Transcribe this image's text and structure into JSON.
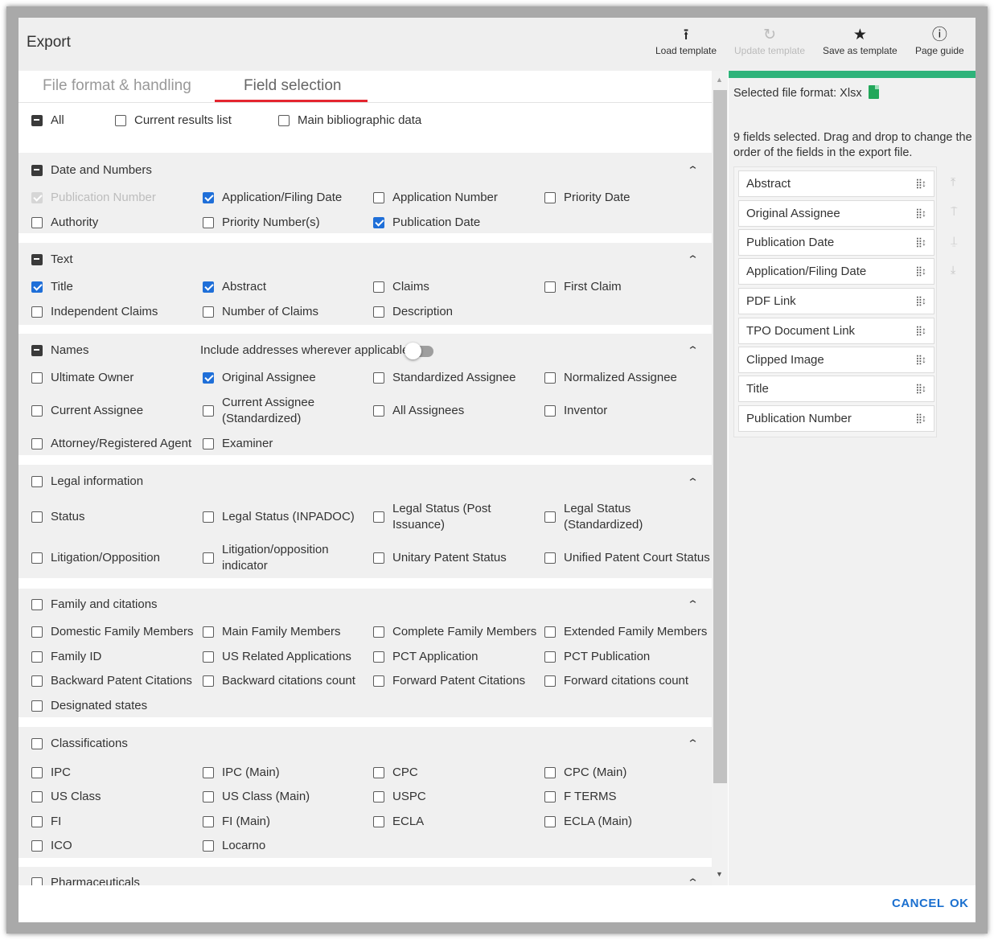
{
  "dialog": {
    "title": "Export"
  },
  "toolbar": [
    {
      "label": "Load template",
      "icon": "upload-icon",
      "enabled": true
    },
    {
      "label": "Update template",
      "icon": "refresh-icon",
      "enabled": false
    },
    {
      "label": "Save as template",
      "icon": "star-icon",
      "enabled": true
    },
    {
      "label": "Page guide",
      "icon": "info-icon",
      "enabled": true
    }
  ],
  "tabs": [
    {
      "label": "File format & handling",
      "active": false
    },
    {
      "label": "Field selection",
      "active": true
    }
  ],
  "top_checks": [
    {
      "label": "All",
      "state": "indeterminate"
    },
    {
      "label": "Current results list",
      "state": "unchecked"
    },
    {
      "label": "Main bibliographic data",
      "state": "unchecked"
    }
  ],
  "sections": {
    "date_numbers": {
      "title": "Date and Numbers",
      "state": "indeterminate",
      "fields": [
        {
          "label": "Publication Number",
          "state": "disabled"
        },
        {
          "label": "Application/Filing Date",
          "state": "checked"
        },
        {
          "label": "Application Number",
          "state": "unchecked"
        },
        {
          "label": "Priority Date",
          "state": "unchecked"
        },
        {
          "label": "Authority",
          "state": "unchecked"
        },
        {
          "label": "Priority Number(s)",
          "state": "unchecked"
        },
        {
          "label": "Publication Date",
          "state": "checked"
        }
      ]
    },
    "text": {
      "title": "Text",
      "state": "indeterminate",
      "fields": [
        {
          "label": "Title",
          "state": "checked"
        },
        {
          "label": "Abstract",
          "state": "checked"
        },
        {
          "label": "Claims",
          "state": "unchecked"
        },
        {
          "label": "First Claim",
          "state": "unchecked"
        },
        {
          "label": "Independent Claims",
          "state": "unchecked"
        },
        {
          "label": "Number of Claims",
          "state": "unchecked"
        },
        {
          "label": "Description",
          "state": "unchecked"
        }
      ]
    },
    "names": {
      "title": "Names",
      "state": "indeterminate",
      "addresses_label": "Include addresses wherever applicable",
      "fields": [
        {
          "label": "Ultimate Owner",
          "state": "unchecked"
        },
        {
          "label": "Original Assignee",
          "state": "checked"
        },
        {
          "label": "Standardized Assignee",
          "state": "unchecked"
        },
        {
          "label": "Normalized Assignee",
          "state": "unchecked"
        },
        {
          "label": "Current Assignee",
          "state": "unchecked"
        },
        {
          "label": "Current Assignee (Standardized)",
          "state": "unchecked"
        },
        {
          "label": "All Assignees",
          "state": "unchecked"
        },
        {
          "label": "Inventor",
          "state": "unchecked"
        },
        {
          "label": "Attorney/Registered Agent",
          "state": "unchecked"
        },
        {
          "label": "Examiner",
          "state": "unchecked"
        }
      ]
    },
    "legal": {
      "title": "Legal information",
      "state": "unchecked",
      "fields": [
        {
          "label": "Status",
          "state": "unchecked"
        },
        {
          "label": "Legal Status (INPADOC)",
          "state": "unchecked"
        },
        {
          "label": "Legal Status (Post Issuance)",
          "state": "unchecked"
        },
        {
          "label": "Legal Status (Standardized)",
          "state": "unchecked"
        },
        {
          "label": "Litigation/Opposition",
          "state": "unchecked"
        },
        {
          "label": "Litigation/opposition indicator",
          "state": "unchecked"
        },
        {
          "label": "Unitary Patent Status",
          "state": "unchecked"
        },
        {
          "label": "Unified Patent Court Status",
          "state": "unchecked"
        }
      ]
    },
    "family": {
      "title": "Family and citations",
      "state": "unchecked",
      "fields": [
        {
          "label": "Domestic Family Members",
          "state": "unchecked"
        },
        {
          "label": "Main Family Members",
          "state": "unchecked"
        },
        {
          "label": "Complete Family Members",
          "state": "unchecked"
        },
        {
          "label": "Extended Family Members",
          "state": "unchecked"
        },
        {
          "label": "Family ID",
          "state": "unchecked"
        },
        {
          "label": "US Related Applications",
          "state": "unchecked"
        },
        {
          "label": "PCT Application",
          "state": "unchecked"
        },
        {
          "label": "PCT Publication",
          "state": "unchecked"
        },
        {
          "label": "Backward Patent Citations",
          "state": "unchecked"
        },
        {
          "label": "Backward citations count",
          "state": "unchecked"
        },
        {
          "label": "Forward Patent Citations",
          "state": "unchecked"
        },
        {
          "label": "Forward citations count",
          "state": "unchecked"
        },
        {
          "label": "Designated states",
          "state": "unchecked"
        }
      ]
    },
    "classifications": {
      "title": "Classifications",
      "state": "unchecked",
      "fields": [
        {
          "label": "IPC",
          "state": "unchecked"
        },
        {
          "label": "IPC (Main)",
          "state": "unchecked"
        },
        {
          "label": "CPC",
          "state": "unchecked"
        },
        {
          "label": "CPC (Main)",
          "state": "unchecked"
        },
        {
          "label": "US Class",
          "state": "unchecked"
        },
        {
          "label": "US Class (Main)",
          "state": "unchecked"
        },
        {
          "label": "USPC",
          "state": "unchecked"
        },
        {
          "label": "F TERMS",
          "state": "unchecked"
        },
        {
          "label": "FI",
          "state": "unchecked"
        },
        {
          "label": "FI (Main)",
          "state": "unchecked"
        },
        {
          "label": "ECLA",
          "state": "unchecked"
        },
        {
          "label": "ECLA (Main)",
          "state": "unchecked"
        },
        {
          "label": "ICO",
          "state": "unchecked"
        },
        {
          "label": "Locarno",
          "state": "unchecked"
        }
      ]
    },
    "pharma": {
      "title": "Pharmaceuticals",
      "state": "unchecked"
    }
  },
  "right_panel": {
    "file_format_label": "Selected file format: Xlsx",
    "selected_summary": "9 fields selected. Drag and drop to change the order of the fields in the export file.",
    "selected_fields": [
      "Abstract",
      "Original Assignee",
      "Publication Date",
      "Application/Filing Date",
      "PDF Link",
      "TPO Document Link",
      "Clipped Image",
      "Title",
      "Publication Number"
    ],
    "drag_handle": "⣿↕"
  },
  "footer": {
    "cancel_label": "CANCEL",
    "ok_label": "OK"
  },
  "colors": {
    "accent": "#1f6fd8",
    "tab_underline": "#e4252f",
    "progress": "#2eb37a",
    "button": "#1a6fcf"
  }
}
